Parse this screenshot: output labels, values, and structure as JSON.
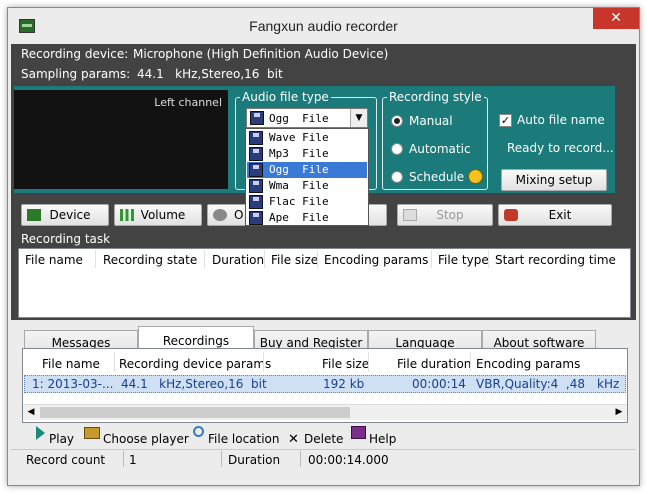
{
  "window": {
    "title": "Fangxun audio recorder",
    "close_glyph": "✕"
  },
  "info": {
    "device_label": "Recording device:",
    "device_value": "Microphone (High Definition Audio Device)",
    "params_label": "Sampling  params:",
    "params_value": "44.1   kHz,Stereo,16  bit"
  },
  "scope": {
    "channel_label": "Left channel"
  },
  "file_type": {
    "legend": "Audio file type",
    "selected": "Ogg  File",
    "options": [
      "Wave File",
      "Mp3  File",
      "Ogg  File",
      "Wma  File",
      "Flac File",
      "Ape  File"
    ],
    "selected_index": 2
  },
  "style": {
    "legend": "Recording style",
    "manual": "Manual",
    "automatic": "Automatic",
    "schedule": "Schedule"
  },
  "auto": {
    "label": "Auto file name",
    "checked": true,
    "status": "Ready to record...",
    "mixing": "Mixing setup"
  },
  "buttons": {
    "device": "Device",
    "volume": "Volume",
    "options_partial": "O",
    "stop": "Stop",
    "exit": "Exit"
  },
  "task": {
    "title": "Recording task",
    "columns": [
      "File name",
      "Recording state",
      "Duration",
      "File size",
      "Encoding params",
      "File type",
      "Start recording time"
    ]
  },
  "tabs": [
    "Messages",
    "Recordings",
    "Buy and Register",
    "Language",
    "About software"
  ],
  "active_tab": 1,
  "recordings": {
    "columns": [
      "File name",
      "Recording device params",
      "File size",
      "File duration",
      "Encoding params"
    ],
    "rows": [
      {
        "name": "1: 2013-03-...",
        "params": "44.1   kHz,Stereo,16  bit",
        "size": "192 kb",
        "duration": "00:00:14",
        "encoding": "VBR,Quality:4  ,48",
        "extra": "kHz"
      }
    ]
  },
  "toolbar": {
    "play": "Play",
    "choose": "Choose player",
    "location": "File location",
    "delete": "Delete",
    "help": "Help"
  },
  "status": {
    "count_label": "Record count",
    "count_value": "1",
    "duration_label": "Duration",
    "duration_value": "00:00:14.000"
  },
  "colors": {
    "panel": "#1a7b7a",
    "client": "#434343",
    "selection": "#3a79d5",
    "close": "#c7352b"
  }
}
